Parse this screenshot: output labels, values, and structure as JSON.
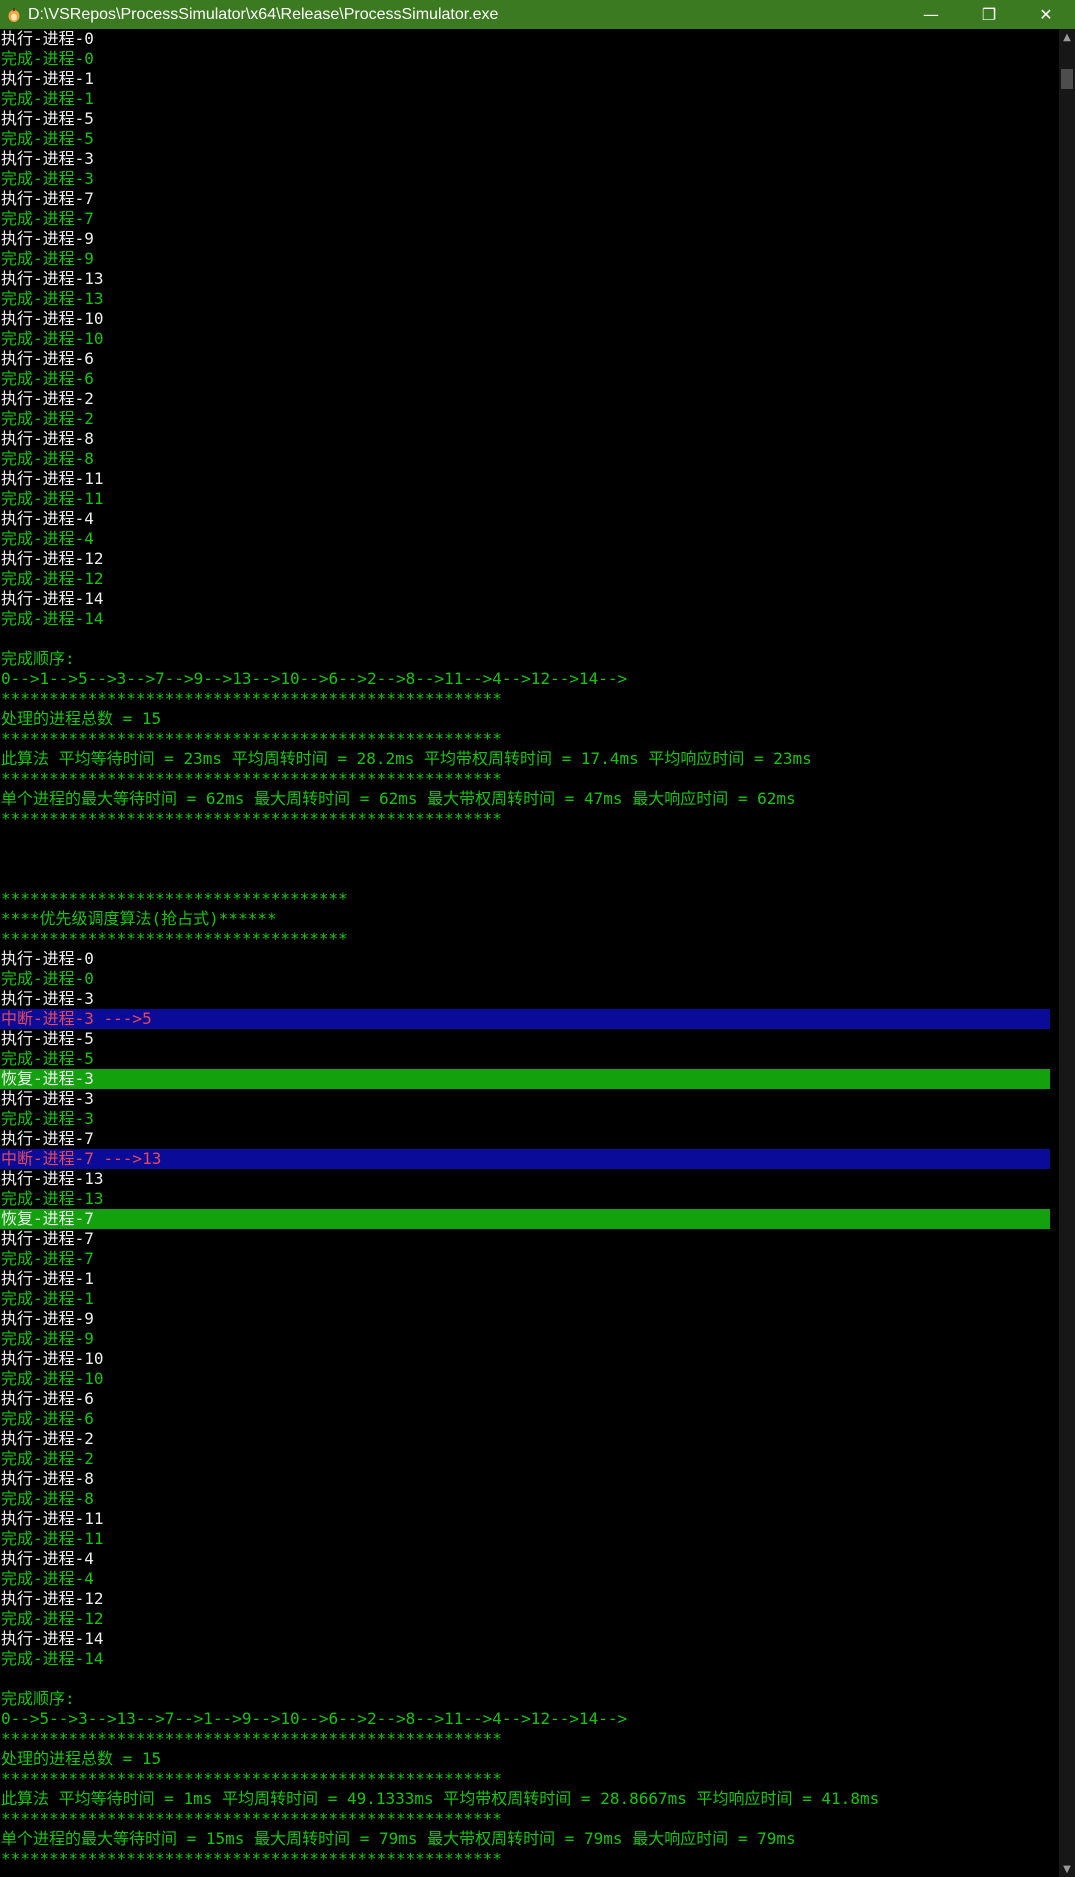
{
  "window": {
    "title": "D:\\VSRepos\\ProcessSimulator\\x64\\Release\\ProcessSimulator.exe",
    "minimize_glyph": "—",
    "maximize_glyph": "❐",
    "close_glyph": "✕",
    "icon": "app-icon"
  },
  "scrollbar": {
    "up_glyph": "▲",
    "down_glyph": "▼"
  },
  "console_lines": [
    {
      "text": "执行-进程-0",
      "style": "white"
    },
    {
      "text": "完成-进程-0",
      "style": "green"
    },
    {
      "text": "执行-进程-1",
      "style": "white"
    },
    {
      "text": "完成-进程-1",
      "style": "green"
    },
    {
      "text": "执行-进程-5",
      "style": "white"
    },
    {
      "text": "完成-进程-5",
      "style": "green"
    },
    {
      "text": "执行-进程-3",
      "style": "white"
    },
    {
      "text": "完成-进程-3",
      "style": "green"
    },
    {
      "text": "执行-进程-7",
      "style": "white"
    },
    {
      "text": "完成-进程-7",
      "style": "green"
    },
    {
      "text": "执行-进程-9",
      "style": "white"
    },
    {
      "text": "完成-进程-9",
      "style": "green"
    },
    {
      "text": "执行-进程-13",
      "style": "white"
    },
    {
      "text": "完成-进程-13",
      "style": "green"
    },
    {
      "text": "执行-进程-10",
      "style": "white"
    },
    {
      "text": "完成-进程-10",
      "style": "green"
    },
    {
      "text": "执行-进程-6",
      "style": "white"
    },
    {
      "text": "完成-进程-6",
      "style": "green"
    },
    {
      "text": "执行-进程-2",
      "style": "white"
    },
    {
      "text": "完成-进程-2",
      "style": "green"
    },
    {
      "text": "执行-进程-8",
      "style": "white"
    },
    {
      "text": "完成-进程-8",
      "style": "green"
    },
    {
      "text": "执行-进程-11",
      "style": "white"
    },
    {
      "text": "完成-进程-11",
      "style": "green"
    },
    {
      "text": "执行-进程-4",
      "style": "white"
    },
    {
      "text": "完成-进程-4",
      "style": "green"
    },
    {
      "text": "执行-进程-12",
      "style": "white"
    },
    {
      "text": "完成-进程-12",
      "style": "green"
    },
    {
      "text": "执行-进程-14",
      "style": "white"
    },
    {
      "text": "完成-进程-14",
      "style": "green"
    },
    {
      "text": "",
      "style": "green"
    },
    {
      "text": "完成顺序:",
      "style": "green"
    },
    {
      "text": "0-->1-->5-->3-->7-->9-->13-->10-->6-->2-->8-->11-->4-->12-->14-->",
      "style": "green"
    },
    {
      "text": "****************************************************",
      "style": "green"
    },
    {
      "text": "处理的进程总数 = 15",
      "style": "green"
    },
    {
      "text": "****************************************************",
      "style": "green"
    },
    {
      "text": "此算法 平均等待时间 = 23ms 平均周转时间 = 28.2ms 平均带权周转时间 = 17.4ms 平均响应时间 = 23ms",
      "style": "green"
    },
    {
      "text": "****************************************************",
      "style": "green"
    },
    {
      "text": "单个进程的最大等待时间 = 62ms 最大周转时间 = 62ms 最大带权周转时间 = 47ms 最大响应时间 = 62ms",
      "style": "green"
    },
    {
      "text": "****************************************************",
      "style": "green"
    },
    {
      "text": "",
      "style": "green"
    },
    {
      "text": "",
      "style": "green"
    },
    {
      "text": "",
      "style": "green"
    },
    {
      "text": "************************************",
      "style": "green"
    },
    {
      "text": "****优先级调度算法(抢占式)******",
      "style": "green"
    },
    {
      "text": "************************************",
      "style": "green"
    },
    {
      "text": "执行-进程-0",
      "style": "white"
    },
    {
      "text": "完成-进程-0",
      "style": "green"
    },
    {
      "text": "执行-进程-3",
      "style": "white"
    },
    {
      "text": "中断-进程-3 --->5",
      "style": "red-blue"
    },
    {
      "text": "执行-进程-5",
      "style": "white"
    },
    {
      "text": "完成-进程-5",
      "style": "green"
    },
    {
      "text": "恢复-进程-3",
      "style": "white-green"
    },
    {
      "text": "执行-进程-3",
      "style": "white"
    },
    {
      "text": "完成-进程-3",
      "style": "green"
    },
    {
      "text": "执行-进程-7",
      "style": "white"
    },
    {
      "text": "中断-进程-7 --->13",
      "style": "red-blue"
    },
    {
      "text": "执行-进程-13",
      "style": "white"
    },
    {
      "text": "完成-进程-13",
      "style": "green"
    },
    {
      "text": "恢复-进程-7",
      "style": "white-green"
    },
    {
      "text": "执行-进程-7",
      "style": "white"
    },
    {
      "text": "完成-进程-7",
      "style": "green"
    },
    {
      "text": "执行-进程-1",
      "style": "white"
    },
    {
      "text": "完成-进程-1",
      "style": "green"
    },
    {
      "text": "执行-进程-9",
      "style": "white"
    },
    {
      "text": "完成-进程-9",
      "style": "green"
    },
    {
      "text": "执行-进程-10",
      "style": "white"
    },
    {
      "text": "完成-进程-10",
      "style": "green"
    },
    {
      "text": "执行-进程-6",
      "style": "white"
    },
    {
      "text": "完成-进程-6",
      "style": "green"
    },
    {
      "text": "执行-进程-2",
      "style": "white"
    },
    {
      "text": "完成-进程-2",
      "style": "green"
    },
    {
      "text": "执行-进程-8",
      "style": "white"
    },
    {
      "text": "完成-进程-8",
      "style": "green"
    },
    {
      "text": "执行-进程-11",
      "style": "white"
    },
    {
      "text": "完成-进程-11",
      "style": "green"
    },
    {
      "text": "执行-进程-4",
      "style": "white"
    },
    {
      "text": "完成-进程-4",
      "style": "green"
    },
    {
      "text": "执行-进程-12",
      "style": "white"
    },
    {
      "text": "完成-进程-12",
      "style": "green"
    },
    {
      "text": "执行-进程-14",
      "style": "white"
    },
    {
      "text": "完成-进程-14",
      "style": "green"
    },
    {
      "text": "",
      "style": "green"
    },
    {
      "text": "完成顺序:",
      "style": "green"
    },
    {
      "text": "0-->5-->3-->13-->7-->1-->9-->10-->6-->2-->8-->11-->4-->12-->14-->",
      "style": "green"
    },
    {
      "text": "****************************************************",
      "style": "green"
    },
    {
      "text": "处理的进程总数 = 15",
      "style": "green"
    },
    {
      "text": "****************************************************",
      "style": "green"
    },
    {
      "text": "此算法 平均等待时间 = 1ms 平均周转时间 = 49.1333ms 平均带权周转时间 = 28.8667ms 平均响应时间 = 41.8ms",
      "style": "green"
    },
    {
      "text": "****************************************************",
      "style": "green"
    },
    {
      "text": "单个进程的最大等待时间 = 15ms 最大周转时间 = 79ms 最大带权周转时间 = 79ms 最大响应时间 = 79ms",
      "style": "green"
    },
    {
      "text": "****************************************************",
      "style": "green"
    }
  ],
  "colors": {
    "titlebar": "#3c7a21",
    "console_bg": "#000000",
    "text_white": "#f0f0f0",
    "text_green": "#16c60c",
    "interrupt_fg": "#e74856",
    "interrupt_bg": "#0b0b99",
    "resume_bg": "#13a10e"
  }
}
